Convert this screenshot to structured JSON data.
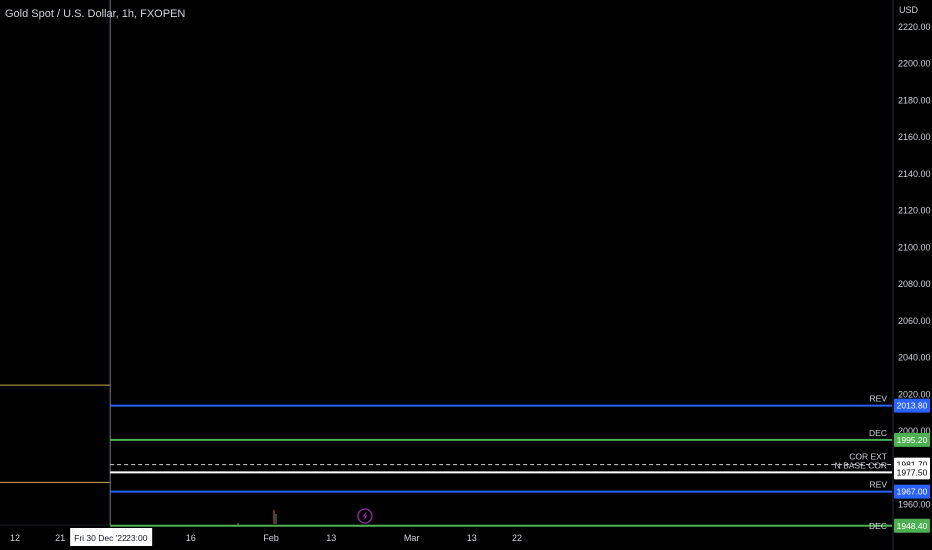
{
  "header": {
    "symbol_title": "Gold Spot / U.S. Dollar, 1h, FXOPEN",
    "currency": "USD"
  },
  "crosshair": {
    "date_label": "Fri 30 Dec '22",
    "time_label": "23:00"
  },
  "colors": {
    "background": "#000000",
    "text": "#d1d4dc",
    "blue_level": "#2962ff",
    "green_level": "#4caf50",
    "white_level": "#ffffff",
    "dashed_level": "#d1d4dc",
    "gold_line": "#c8a951",
    "event_icon": "#9c27b0",
    "crosshair": "#787b86"
  },
  "chart_data": {
    "type": "line",
    "title": "Gold Spot / U.S. Dollar, 1h, FXOPEN",
    "y_axis": {
      "unit": "USD",
      "ylim": [
        1945,
        2225
      ],
      "ticks": [
        2220,
        2200,
        2180,
        2160,
        2140,
        2120,
        2100,
        2080,
        2060,
        2040,
        2020,
        2000,
        1960
      ]
    },
    "x_axis": {
      "ticks": [
        {
          "label": "12",
          "date": "2022-12-12"
        },
        {
          "label": "21",
          "date": "2022-12-21"
        },
        {
          "label": "16",
          "date": "2023-01-16"
        },
        {
          "label": "Feb",
          "date": "2023-02-01"
        },
        {
          "label": "13",
          "date": "2023-02-13"
        },
        {
          "label": "Mar",
          "date": "2023-03-01"
        },
        {
          "label": "13",
          "date": "2023-03-13"
        },
        {
          "label": "22",
          "date": "2023-03-22"
        }
      ],
      "crosshair_date": "2022-12-30T23:00"
    },
    "horizontal_levels": [
      {
        "label": "REV",
        "value": 2013.8,
        "value_label": "2013.80",
        "color": "blue",
        "style": "solid",
        "start_date": "2022-12-30T23:00"
      },
      {
        "label": "DEC",
        "value": 1995.2,
        "value_label": "1995.20",
        "color": "green",
        "style": "solid",
        "start_date": "2022-12-30T23:00"
      },
      {
        "label": "COR EXT",
        "value": 1981.7,
        "value_label": "1981.70",
        "color": "dashed",
        "style": "dashed",
        "start_date": "2022-12-30T23:00"
      },
      {
        "label": "N BASE COR",
        "value": 1977.5,
        "value_label": "1977.50",
        "color": "white",
        "style": "solid",
        "start_date": "2022-12-30T23:00"
      },
      {
        "label": "REV",
        "value": 1967.0,
        "value_label": "1967.00",
        "color": "blue",
        "style": "solid",
        "start_date": "2022-12-30T23:00"
      },
      {
        "label": "DEC",
        "value": 1948.4,
        "value_label": "1948.40",
        "color": "green",
        "style": "solid",
        "start_date": "2022-12-30T23:00"
      }
    ],
    "historical_lines": [
      {
        "value": 2025.0,
        "color": "gold",
        "end_date": "2022-12-30T23:00"
      },
      {
        "value": 1972.0,
        "color": "gold",
        "end_date": "2022-12-30T23:00"
      }
    ],
    "grid": false
  }
}
